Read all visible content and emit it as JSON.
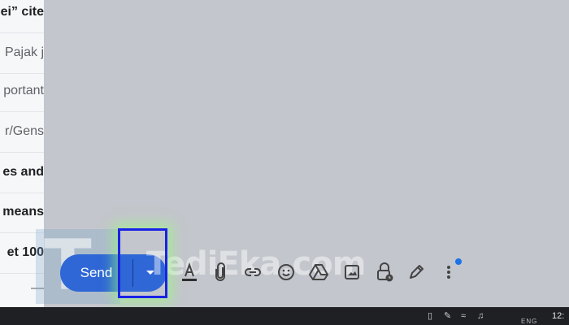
{
  "email_list": [
    {
      "text": "ei” cite",
      "bold": true
    },
    {
      "text": "Pajak j",
      "bold": false
    },
    {
      "text": "portant",
      "bold": false
    },
    {
      "text": "r/Gens",
      "bold": false
    },
    {
      "text": "es and",
      "bold": true
    },
    {
      "text": "means",
      "bold": true
    },
    {
      "text": "et 100",
      "bold": true
    },
    {
      "text": "—",
      "bold": false
    }
  ],
  "compose": {
    "send_label": "Send",
    "more_send_options_icon": "caret-down-icon"
  },
  "toolbar": {
    "icons": [
      "format-text-icon",
      "attach-file-icon",
      "insert-link-icon",
      "insert-emoji-icon",
      "google-drive-icon",
      "insert-photo-icon",
      "confidential-mode-icon",
      "signature-pen-icon",
      "more-options-icon"
    ]
  },
  "watermark": {
    "letter": "T",
    "text": "TediEka.com"
  },
  "taskbar": {
    "time": "12:",
    "lang": "ENG"
  },
  "colors": {
    "accent": "#2f67d6",
    "highlight": "#1a22e6",
    "notification": "#1a73e8",
    "taskbar": "#1f2023"
  }
}
